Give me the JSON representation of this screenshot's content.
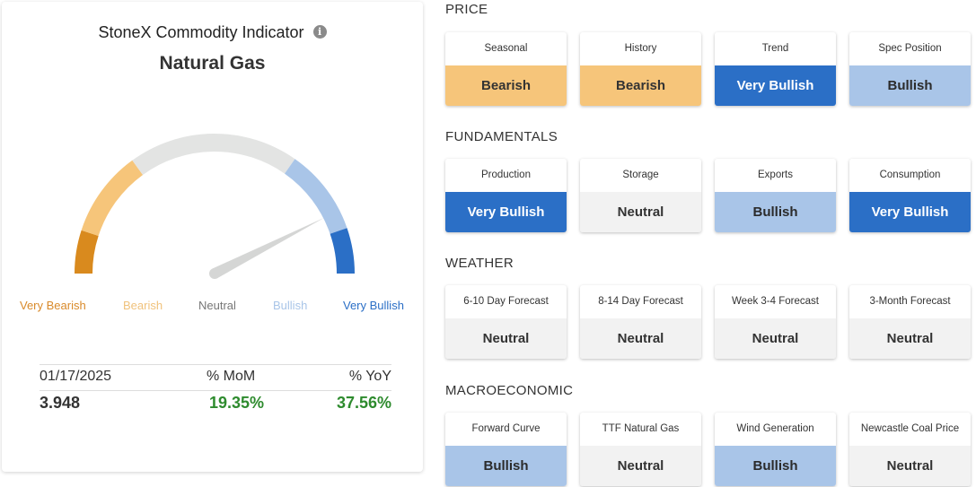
{
  "indicator": {
    "title": "StoneX Commodity Indicator",
    "info_icon": "i",
    "commodity": "Natural Gas",
    "gauge_labels": [
      {
        "text": "Very Bearish",
        "color": "#d98a2a"
      },
      {
        "text": "Bearish",
        "color": "#f0c27c"
      },
      {
        "text": "Neutral",
        "color": "#777777"
      },
      {
        "text": "Bullish",
        "color": "#a9c5e8"
      },
      {
        "text": "Very Bullish",
        "color": "#2b6fc6"
      }
    ],
    "gauge_value_fraction": 0.85,
    "stats": {
      "date": "01/17/2025",
      "mom_label": "% MoM",
      "yoy_label": "% YoY",
      "price": "3.948",
      "mom": "19.35%",
      "yoy": "37.56%"
    }
  },
  "sections": [
    {
      "title": "PRICE",
      "tiles": [
        {
          "label": "Seasonal",
          "value": "Bearish",
          "level": "bearish"
        },
        {
          "label": "History",
          "value": "Bearish",
          "level": "bearish"
        },
        {
          "label": "Trend",
          "value": "Very Bullish",
          "level": "verybullish"
        },
        {
          "label": "Spec Position",
          "value": "Bullish",
          "level": "bullish"
        }
      ]
    },
    {
      "title": "FUNDAMENTALS",
      "tiles": [
        {
          "label": "Production",
          "value": "Very Bullish",
          "level": "verybullish"
        },
        {
          "label": "Storage",
          "value": "Neutral",
          "level": "neutral"
        },
        {
          "label": "Exports",
          "value": "Bullish",
          "level": "bullish"
        },
        {
          "label": "Consumption",
          "value": "Very Bullish",
          "level": "verybullish"
        }
      ]
    },
    {
      "title": "WEATHER",
      "tiles": [
        {
          "label": "6-10 Day Forecast",
          "value": "Neutral",
          "level": "neutral"
        },
        {
          "label": "8-14 Day Forecast",
          "value": "Neutral",
          "level": "neutral"
        },
        {
          "label": "Week 3-4 Forecast",
          "value": "Neutral",
          "level": "neutral"
        },
        {
          "label": "3-Month Forecast",
          "value": "Neutral",
          "level": "neutral"
        }
      ]
    },
    {
      "title": "MACROECONOMIC",
      "tiles": [
        {
          "label": "Forward Curve",
          "value": "Bullish",
          "level": "bullish"
        },
        {
          "label": "TTF Natural Gas",
          "value": "Neutral",
          "level": "neutral"
        },
        {
          "label": "Wind Generation",
          "value": "Bullish",
          "level": "bullish"
        },
        {
          "label": "Newcastle Coal Price",
          "value": "Neutral",
          "level": "neutral"
        }
      ]
    }
  ]
}
